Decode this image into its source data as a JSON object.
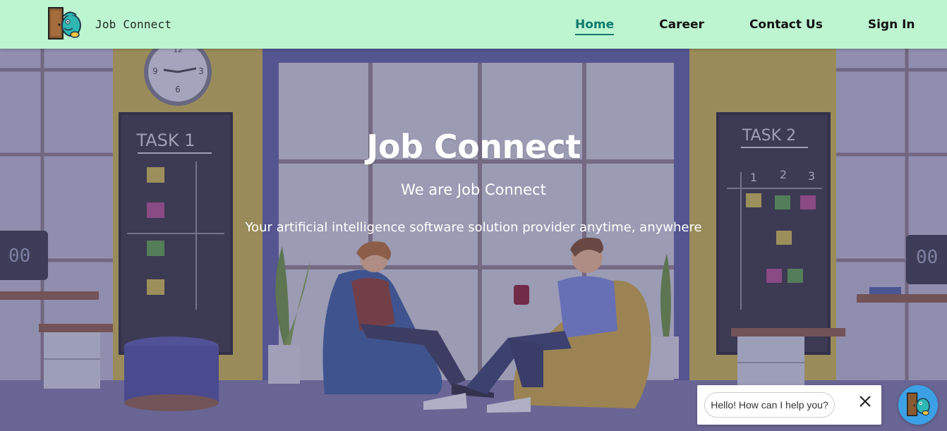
{
  "brand": {
    "name": "Job Connect",
    "logo_icon": "door-character-icon"
  },
  "nav": {
    "items": [
      {
        "label": "Home",
        "active": true
      },
      {
        "label": "Career",
        "active": false
      },
      {
        "label": "Contact Us",
        "active": false
      },
      {
        "label": "Sign In",
        "active": false
      }
    ]
  },
  "hero": {
    "title": "Job Connect",
    "subtitle": "We are Job Connect",
    "description": "Your artificial intelligence software solution provider anytime, anywhere",
    "background": {
      "task_board_left": "TASK 1",
      "task_board_right": "TASK 2",
      "task_board_right_columns": [
        "1",
        "2",
        "3"
      ],
      "clock_numbers": [
        "12",
        "3",
        "6",
        "9"
      ],
      "monitor_text": "00"
    }
  },
  "chat": {
    "greeting": "Hello! How can I help you?",
    "close_icon": "close-icon",
    "launcher_icon": "door-character-icon"
  },
  "colors": {
    "navbar_bg": "#bdf5d0",
    "active_link": "#0d7a6c",
    "chat_launcher": "#3ba0e6"
  }
}
